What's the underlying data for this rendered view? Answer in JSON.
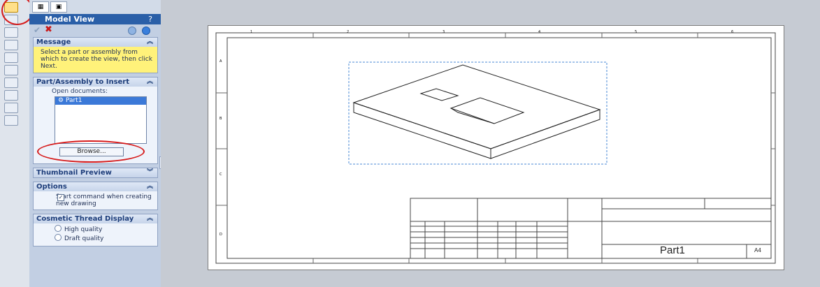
{
  "property_manager": {
    "title": "Model View",
    "help_icon": "?",
    "groups": {
      "message": {
        "header": "Message",
        "text": "Select a part or assembly from which to create the view, then click Next."
      },
      "part_assembly": {
        "header": "Part/Assembly to Insert",
        "open_documents_label": "Open documents:",
        "documents": [
          "Part1"
        ],
        "browse_label": "Browse..."
      },
      "thumbnail": {
        "header": "Thumbnail Preview"
      },
      "options": {
        "header": "Options",
        "start_command_label": "Start command when creating new drawing",
        "start_command_checked": true
      },
      "cosmetic": {
        "header": "Cosmetic Thread Display",
        "high_quality": "High quality",
        "draft_quality": "Draft quality"
      }
    }
  },
  "drawing": {
    "sheet_title": "Part1",
    "sheet_size": "A4",
    "zone_columns": [
      "1",
      "2",
      "3",
      "4",
      "5",
      "6"
    ],
    "zone_rows": [
      "A",
      "B",
      "C",
      "D"
    ]
  },
  "colors": {
    "panel_bg": "#c2cfe3",
    "header_blue": "#2a5fa8",
    "message_yellow": "#fff27a",
    "annotation_red": "#d61a1a"
  }
}
